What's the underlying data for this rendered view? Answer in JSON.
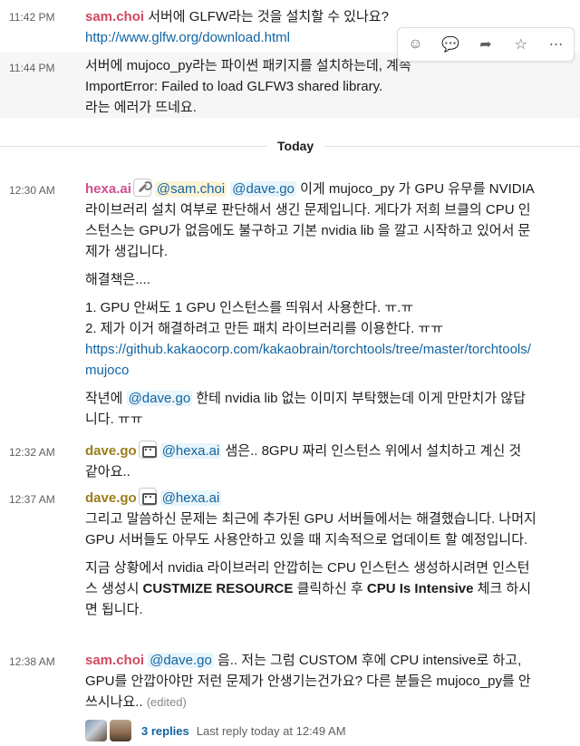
{
  "today_label": "Today",
  "hover_actions": [
    {
      "icon": "add-reaction-icon",
      "glyph": "☺"
    },
    {
      "icon": "reply-in-thread-icon",
      "glyph": "💬"
    },
    {
      "icon": "share-icon",
      "glyph": "➦"
    },
    {
      "icon": "star-icon",
      "glyph": "☆"
    },
    {
      "icon": "more-actions-icon",
      "glyph": "⋯"
    }
  ],
  "messages": [
    {
      "time": "11:42 PM",
      "author": "sam.choi",
      "text": "서버에 GLFW라는 것을 설치할 수 있나요?",
      "link": "http://www.glfw.org/download.html"
    },
    {
      "time": "11:44 PM",
      "line1": "서버에 mujoco_py라는 파이썬 패키지를 설치하는데, 계속",
      "line2": "ImportError: Failed to load GLFW3 shared library.",
      "line3": "라는 에러가 뜨네요."
    },
    {
      "time": "12:30 AM",
      "author": "hexa.ai",
      "mention1": "@sam.choi",
      "mention2": "@dave.go",
      "para1": "이게 mujoco_py 가 GPU 유무를 NVIDIA 라이브러리 설치 여부로 판단해서 생긴 문제입니다.  게다가 저희 브클의 CPU 인스턴스는 GPU가 없음에도 불구하고 기본 nvidia lib 을 깔고 시작하고 있어서 문제가 생깁니다.",
      "para2": "해결책은....",
      "item1": "1. GPU 안써도 1 GPU 인스턴스를 띄워서 사용한다.  ㅠ.ㅠ",
      "item2": "2. 제가 이거 해결하려고 만든 패치 라이브러리를 이용한다.  ㅠㅠ",
      "link": "https://github.kakaocorp.com/kakaobrain/torchtools/tree/master/torchtools/mujoco",
      "para3_pre": "작년에",
      "para3_mention": "@dave.go",
      "para3_post": "한테 nvidia lib 없는 이미지 부탁했는데 이게 만만치가 않답니다.  ㅠㅠ"
    },
    {
      "time": "12:32 AM",
      "author": "dave.go",
      "mention": "@hexa.ai",
      "text": "샘은.. 8GPU 짜리 인스턴스 위에서 설치하고 계신 것 같아요.."
    },
    {
      "time": "12:37 AM",
      "author": "dave.go",
      "mention": "@hexa.ai",
      "para1": "그리고 말씀하신 문제는 최근에 추가된 GPU 서버들에서는 해결했습니다. 나머지 GPU 서버들도 아무도 사용안하고 있을 때 지속적으로 업데이트 할 예정입니다.",
      "para2_pre": "지금 상황에서 nvidia 라이브러리 안깝히는 CPU 인스턴스 생성하시려면 인스턴스 생성시",
      "para2_b1": "CUSTMIZE RESOURCE",
      "para2_mid": "클릭하신 후",
      "para2_b2": "CPU Is Intensive",
      "para2_post": "체크 하시면 됩니다."
    },
    {
      "time": "12:38 AM",
      "author": "sam.choi",
      "mention": "@dave.go",
      "text": "음.. 저는 그럼 CUSTOM 후에 CPU intensive로 하고, GPU를 안깝아야만 저런 문제가 안생기는건가요? 다른 분들은 mujoco_py를 안쓰시나요..",
      "edited": "(edited)",
      "thread_replies": "3 replies",
      "thread_last": "Last reply today at 12:49 AM"
    }
  ]
}
